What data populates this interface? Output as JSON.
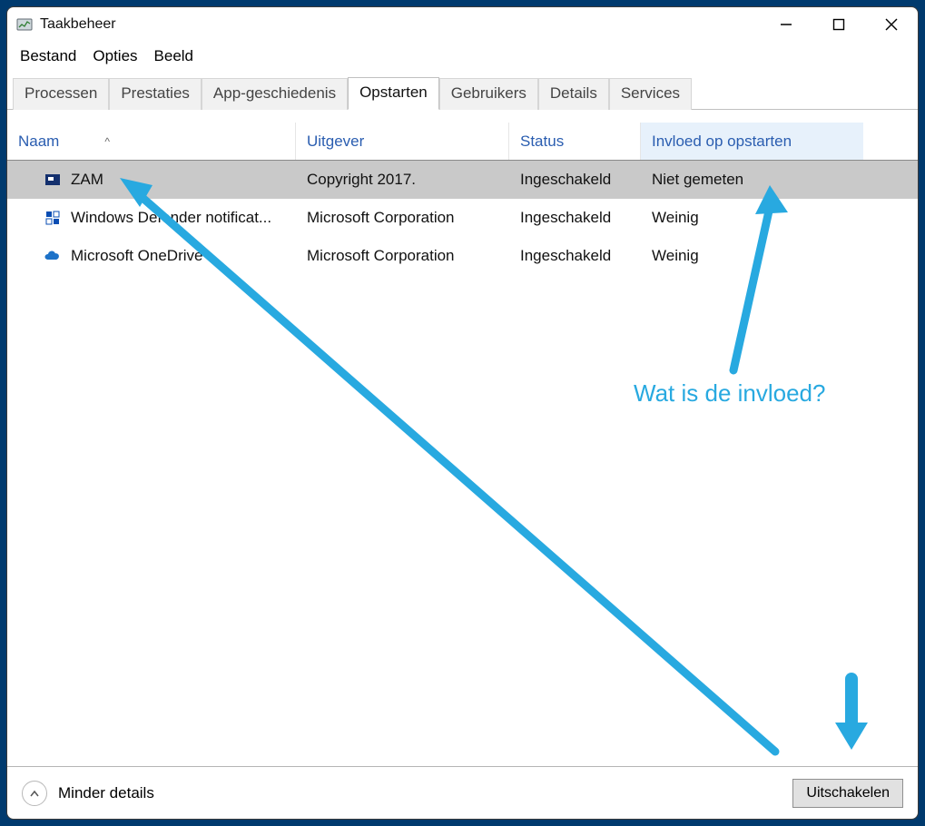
{
  "window": {
    "title": "Taakbeheer"
  },
  "menu": {
    "items": [
      "Bestand",
      "Opties",
      "Beeld"
    ]
  },
  "tabs": {
    "items": [
      "Processen",
      "Prestaties",
      "App-geschiedenis",
      "Opstarten",
      "Gebruikers",
      "Details",
      "Services"
    ],
    "active": "Opstarten"
  },
  "columns": {
    "name": "Naam",
    "publisher": "Uitgever",
    "status": "Status",
    "impact": "Invloed op opstarten",
    "sort_glyph": "^"
  },
  "rows": [
    {
      "name": "ZAM",
      "publisher": "Copyright 2017.",
      "status": "Ingeschakeld",
      "impact": "Niet gemeten",
      "icon": "zam",
      "selected": true
    },
    {
      "name": "Windows Defender notificat...",
      "publisher": "Microsoft Corporation",
      "status": "Ingeschakeld",
      "impact": "Weinig",
      "icon": "shield",
      "selected": false
    },
    {
      "name": "Microsoft OneDrive",
      "publisher": "Microsoft Corporation",
      "status": "Ingeschakeld",
      "impact": "Weinig",
      "icon": "onedrive",
      "selected": false
    }
  ],
  "footer": {
    "less_details": "Minder details",
    "disable": "Uitschakelen"
  },
  "annotation": {
    "text": "Wat is de invloed?",
    "color": "#28a9e0"
  }
}
